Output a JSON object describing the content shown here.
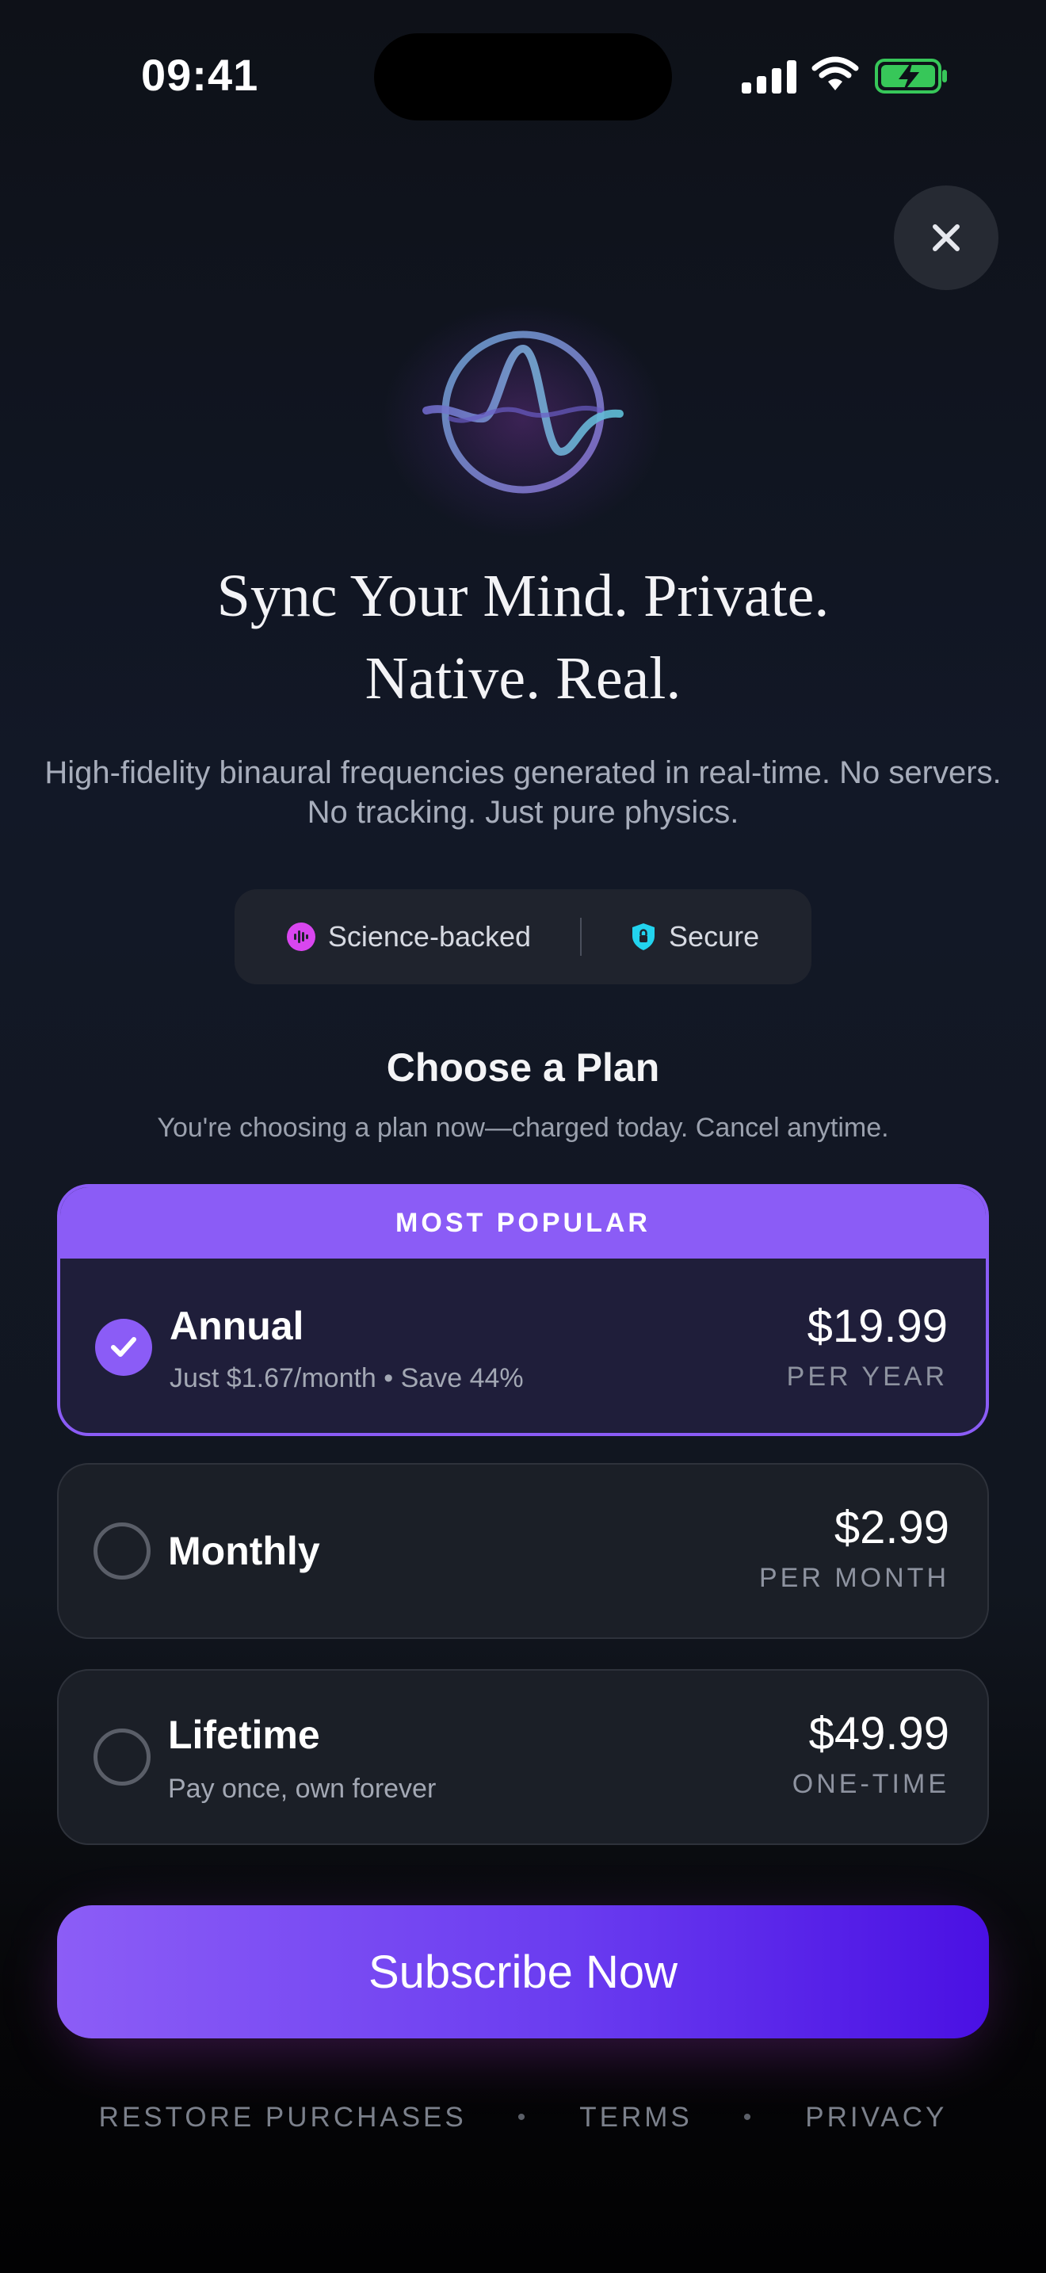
{
  "status_bar": {
    "time": "09:41"
  },
  "hero": {
    "title_line1": "Sync Your Mind. Private.",
    "title_line2": "Native. Real.",
    "subtitle_line1": "High-fidelity binaural frequencies generated in real-time. No servers.",
    "subtitle_line2": "No tracking. Just pure physics."
  },
  "badges": [
    {
      "label": "Science-backed",
      "icon": "waveform-icon",
      "color": "#d946ef"
    },
    {
      "label": "Secure",
      "icon": "shield-lock-icon",
      "color": "#22d3ee"
    }
  ],
  "plans_section": {
    "heading": "Choose a Plan",
    "subheading": "You're choosing a plan now—charged today. Cancel anytime."
  },
  "plans": {
    "annual": {
      "badge": "MOST POPULAR",
      "name": "Annual",
      "desc": "Just $1.67/month • Save 44%",
      "price": "$19.99",
      "period": "PER YEAR",
      "selected": true
    },
    "monthly": {
      "name": "Monthly",
      "price": "$2.99",
      "period": "PER MONTH",
      "selected": false
    },
    "lifetime": {
      "name": "Lifetime",
      "desc": "Pay once, own forever",
      "price": "$49.99",
      "period": "ONE-TIME",
      "selected": false
    }
  },
  "cta": {
    "label": "Subscribe Now"
  },
  "footer": {
    "restore": "RESTORE PURCHASES",
    "terms": "TERMS",
    "privacy": "PRIVACY",
    "separator": "•"
  },
  "colors": {
    "accent": "#8b5cf6",
    "background": "#121827",
    "card": "#1b1f27"
  }
}
